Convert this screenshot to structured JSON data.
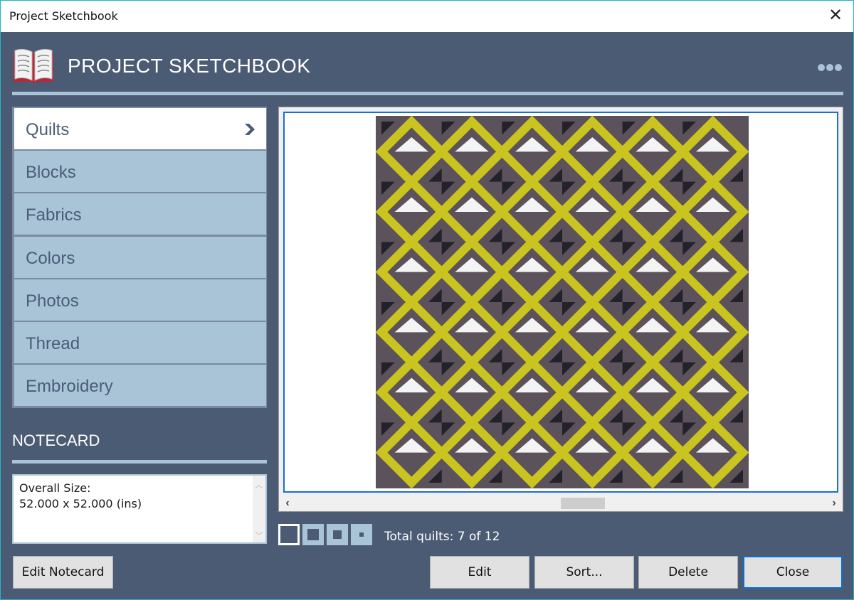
{
  "window": {
    "title": "Project Sketchbook",
    "close_label": "✕"
  },
  "header": {
    "app_title": "PROJECT SKETCHBOOK",
    "icon": "open-book-icon",
    "menu_icon": "more-dots-icon"
  },
  "nav": {
    "items": [
      {
        "label": "Quilts",
        "active": true
      },
      {
        "label": "Blocks",
        "active": false
      },
      {
        "label": "Fabrics",
        "active": false
      },
      {
        "label": "Colors",
        "active": false
      },
      {
        "label": "Photos",
        "active": false
      },
      {
        "label": "Thread",
        "active": false
      },
      {
        "label": "Embroidery",
        "active": false
      }
    ],
    "active_indicator_icon": "chevron-right-icon"
  },
  "notecard": {
    "title": "NOTECARD",
    "text": "Overall Size:\n52.000 x 52.000 (ins)",
    "edit_button": "Edit Notecard"
  },
  "preview": {
    "image": "quilt-preview",
    "scroll_left": "‹",
    "scroll_right": "›",
    "quilt_colors": {
      "background": "#5b525b",
      "lattice": "#c9c41f",
      "triangle_light": "#f4f4f4",
      "pinwheel_dark": "#23222a"
    }
  },
  "zoom_controls": {
    "options": [
      "view-size-large",
      "view-size-medium",
      "view-size-small",
      "view-size-tiny"
    ],
    "selected_index": 0
  },
  "status": {
    "total_quilts": "Total quilts: 7 of 12"
  },
  "actions": {
    "edit": "Edit",
    "sort": "Sort...",
    "delete": "Delete",
    "close": "Close"
  },
  "theme": {
    "panel_bg": "#4b5b74",
    "nav_bg": "#a9c4d6",
    "accent": "#1a6fd0",
    "window_border": "#1fb4c4"
  }
}
